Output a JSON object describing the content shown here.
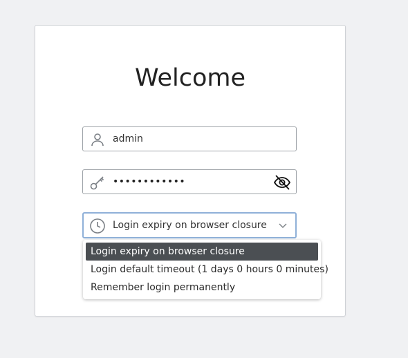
{
  "login": {
    "title": "Welcome",
    "username": {
      "value": "admin",
      "icon": "user-icon"
    },
    "password": {
      "value": "••••••••••••",
      "icon": "key-icon",
      "toggle_icon": "eye-off-icon"
    },
    "expiry": {
      "selected": "Login expiry on browser closure",
      "icon": "clock-icon",
      "options": [
        "Login expiry on browser closure",
        "Login default timeout (1 days 0 hours 0 minutes)",
        "Remember login permanently"
      ]
    }
  },
  "colors": {
    "background": "#f0f1f3",
    "card": "#ffffff",
    "selected_option": "#4b4f53",
    "focus_border": "#8fb0d8"
  }
}
